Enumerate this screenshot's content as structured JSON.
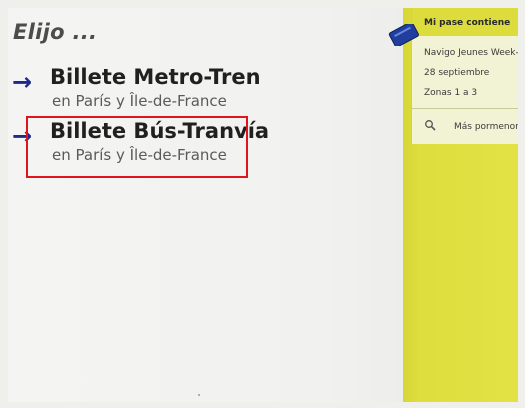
{
  "heading": "Elijo ...",
  "options": [
    {
      "title": "Billete Metro-Tren",
      "subtitle": "en París y Île-de-France"
    },
    {
      "title": "Billete Bús-Tranvía",
      "subtitle": "en París y Île-de-France"
    }
  ],
  "arrow_glyph": "→",
  "pass_panel": {
    "title": "Mi pase contiene",
    "line1": "Navigo Jeunes Week-e",
    "line2": "28 septiembre",
    "line3": "Zonas 1 a 3",
    "details_label": "Más pormenore"
  },
  "colors": {
    "accent_arrow": "#1b2a8f",
    "panel_yellow": "#dede3e",
    "highlight": "#e0141c",
    "card_blue": "#1f3e9e"
  },
  "icons": {
    "card": "pass-card-icon",
    "details": "magnifier-icon"
  }
}
